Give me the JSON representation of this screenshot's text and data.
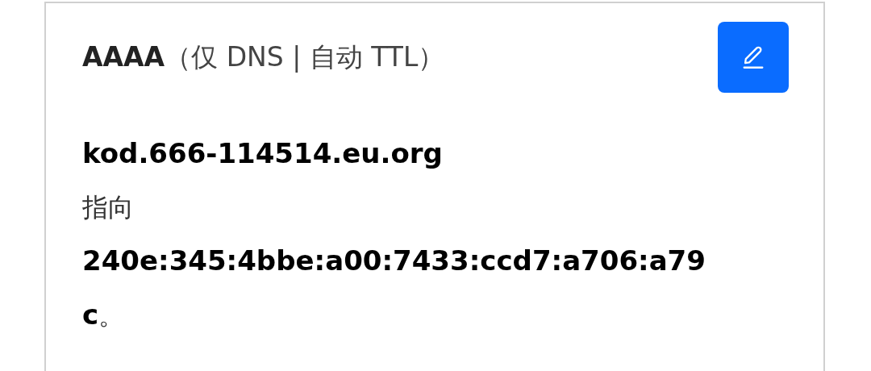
{
  "record": {
    "title": "**AAAA**（仅 DNS | 自动 TTL）",
    "description": "**kod.666-114514.eu.org**\n指向\n**240e:345:4bbe:a00:7433:ccd7:a706:a79c**。"
  }
}
